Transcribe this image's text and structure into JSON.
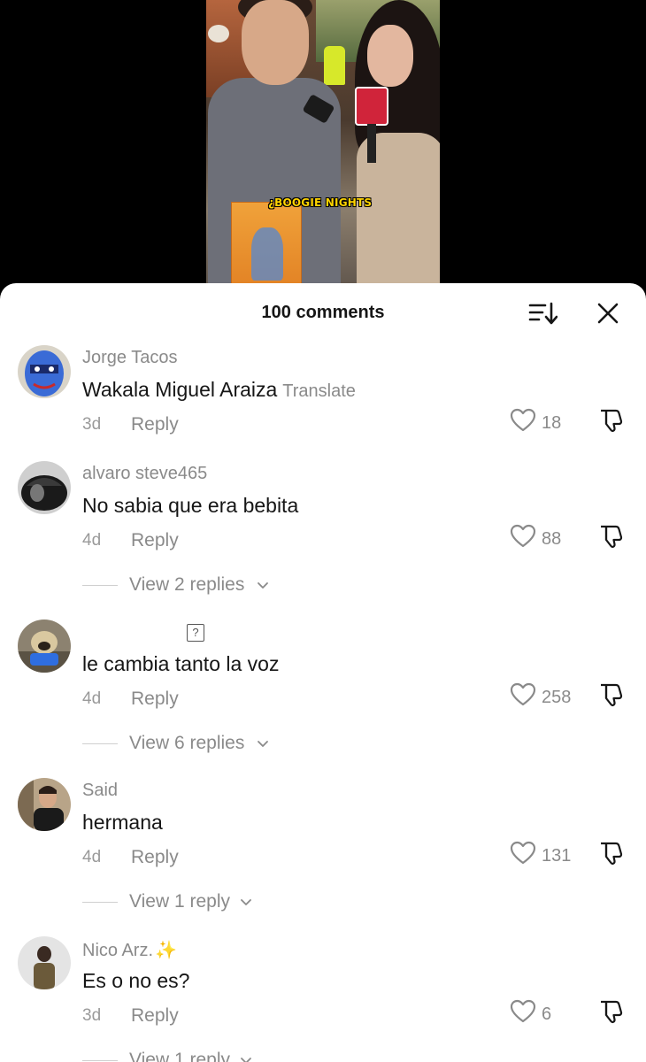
{
  "video": {
    "caption": "¿BOOGIE NIGHTS"
  },
  "sheet": {
    "comments_count": "100 comments",
    "sort_icon": "sort-icon",
    "close_icon": "close-icon"
  },
  "comments": [
    {
      "username": "Jorge Tacos",
      "text": "Wakala Miguel Araiza",
      "translate": "Translate",
      "date": "3d",
      "reply": "Reply",
      "likes": "18",
      "avatar_colors": [
        "#3a6bd6",
        "#c82a2a"
      ]
    },
    {
      "username": "alvaro steve465",
      "text": "No sabia que era bebita",
      "date": "4d",
      "reply": "Reply",
      "likes": "88",
      "view_replies": "View 2 replies",
      "avatar_colors": [
        "#111111",
        "#777777"
      ]
    },
    {
      "username": "?",
      "text": "le cambia tanto la voz",
      "date": "4d",
      "reply": "Reply",
      "likes": "258",
      "view_replies": "View 6 replies",
      "avatar_colors": [
        "#b5a07a",
        "#2f6ee0"
      ]
    },
    {
      "username": "Said",
      "text": "hermana",
      "date": "4d",
      "reply": "Reply",
      "likes": "131",
      "view_replies": "View 1 reply",
      "avatar_colors": [
        "#a89070",
        "#1a1a1a"
      ]
    },
    {
      "username": "Nico Arz.",
      "username_emoji": "✨",
      "text": "Es o no es?",
      "date": "3d",
      "reply": "Reply",
      "likes": "6",
      "view_replies": "View 1 reply",
      "avatar_colors": [
        "#d8d8d8",
        "#6b5a3a"
      ]
    }
  ]
}
